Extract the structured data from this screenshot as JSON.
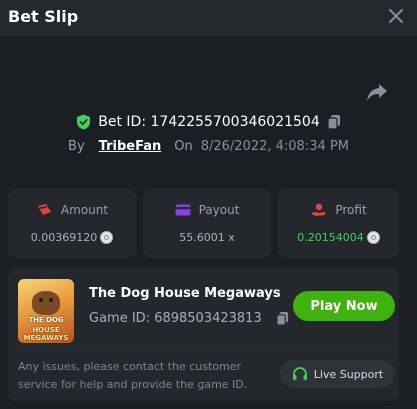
{
  "header": {
    "title": "Bet Slip"
  },
  "bet": {
    "id_label": "Bet ID:",
    "id": "1742255700346021504",
    "by_label": "By",
    "user": "TribeFan",
    "on_label": "On",
    "datetime": "8/26/2022, 4:08:34 PM"
  },
  "stats": [
    {
      "label": "Amount",
      "value": "0.00369120",
      "icon": "bet-amount-icon",
      "coin": true
    },
    {
      "label": "Payout",
      "value": "55.6001 x",
      "icon": "wallet-icon",
      "coin": false
    },
    {
      "label": "Profit",
      "value": "0.20154004",
      "icon": "profit-icon",
      "coin": true
    }
  ],
  "game": {
    "thumb_line1": "THE DOG",
    "thumb_line2": "HOUSE MEGAWAYS",
    "name": "The Dog House Megaways",
    "id_text": "Game ID: 6898503423813",
    "play_label": "Play Now"
  },
  "support": {
    "notice": "Any issues, please contact the customer service for help and provide the game ID.",
    "button_label": "Live Support"
  },
  "colors": {
    "accent_green": "#3fb20f",
    "profit_green": "#3fd25f",
    "icon_red": "#e0443c",
    "icon_purple": "#8a3fe0",
    "background": "#1b1e22",
    "card": "#24272c"
  }
}
